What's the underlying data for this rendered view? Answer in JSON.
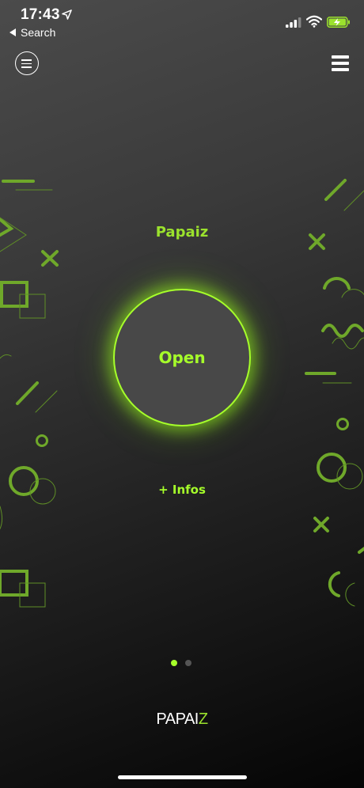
{
  "status_bar": {
    "time": "17:43",
    "back_label": "Search"
  },
  "brand": {
    "title": "Papaiz"
  },
  "main": {
    "open_label": "Open",
    "infos_label": "+ Infos"
  },
  "pagination": {
    "pages": 2,
    "current": 1
  },
  "footer": {
    "logo_main": "PAPAI",
    "logo_accent": "Z"
  },
  "colors": {
    "accent": "#a6ff2a",
    "decor": "#6fa82a",
    "dot_active": "#a6ff2a",
    "dot_inactive": "#555555",
    "battery": "#9be22d"
  },
  "icons": {
    "location": "location-arrow-icon",
    "signal": "cellular-signal-icon",
    "wifi": "wifi-icon",
    "battery": "battery-charging-icon",
    "menu_circle": "menu-circle-icon",
    "hamburger": "hamburger-menu-icon"
  }
}
